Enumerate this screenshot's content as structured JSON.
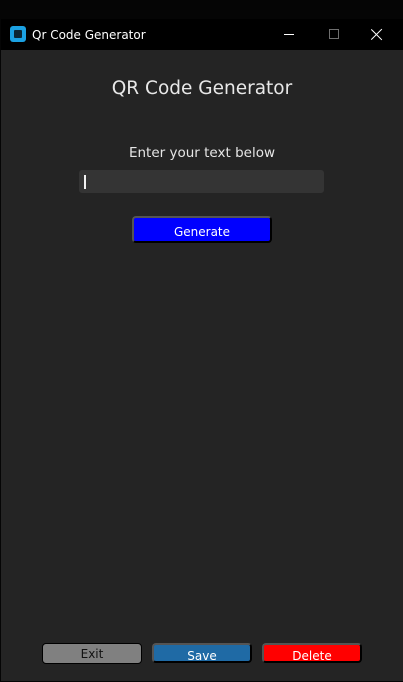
{
  "window": {
    "title": "Qr Code Generator",
    "app_icon": "app-window-icon",
    "controls": {
      "minimize_icon": "minimize-icon",
      "maximize_icon": "maximize-icon",
      "close_icon": "close-icon"
    }
  },
  "main": {
    "heading": "QR Code Generator",
    "prompt": "Enter your text below",
    "input": {
      "value": "",
      "placeholder": ""
    },
    "generate_label": "Generate"
  },
  "footer": {
    "exit_label": "Exit",
    "save_label": "Save",
    "delete_label": "Delete"
  },
  "colors": {
    "background": "#242424",
    "titlebar": "#000000",
    "generate": "#0000ff",
    "exit": "#808080",
    "save": "#1f6aa5",
    "delete": "#ff0000",
    "input_background": "#343434"
  }
}
